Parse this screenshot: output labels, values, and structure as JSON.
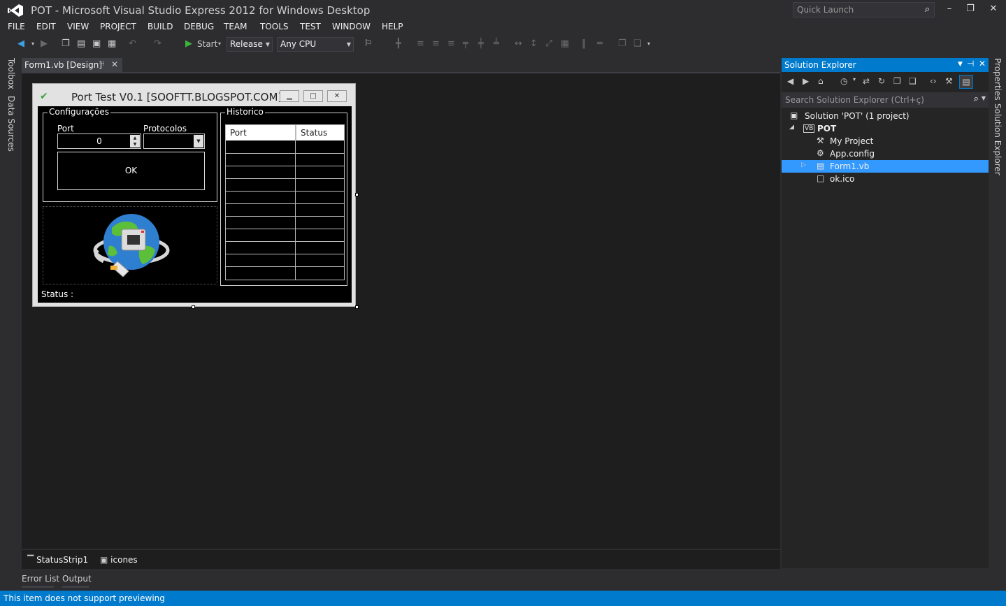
{
  "window": {
    "title": "POT - Microsoft Visual Studio Express 2012 for Windows Desktop",
    "quick_launch_placeholder": "Quick Launch",
    "minimize_glyph": "–",
    "restore_glyph": "❐",
    "close_glyph": "✕"
  },
  "menu": [
    "FILE",
    "EDIT",
    "VIEW",
    "PROJECT",
    "BUILD",
    "DEBUG",
    "TEAM",
    "TOOLS",
    "TEST",
    "WINDOW",
    "HELP"
  ],
  "toolbar": {
    "start_label": "Start",
    "configuration": "Release",
    "platform": "Any CPU"
  },
  "left_rail": {
    "toolbox": "Toolbox",
    "data_sources": "Data Sources"
  },
  "document_tab": {
    "label": "Form1.vb [Design]"
  },
  "form": {
    "title": "Port Test V0.1 [SOOFTT.BLOGSPOT.COM]",
    "config_group": "Configurações",
    "port_label": "Port",
    "port_value": "0",
    "protocol_label": "Protocolos",
    "protocol_value": "",
    "ok_label": "OK",
    "status_label": "Status :",
    "history_group": "Historico",
    "history_columns": [
      "Port",
      "Status"
    ]
  },
  "tray": {
    "item1": "StatusStrip1",
    "item2": "icones"
  },
  "bottom_tabs": {
    "error_list": "Error List",
    "output": "Output"
  },
  "solution_explorer": {
    "title": "Solution Explorer",
    "search_placeholder": "Search Solution Explorer (Ctrl+ç)",
    "tree": [
      {
        "label": "Solution 'POT' (1 project)"
      },
      {
        "label": "POT"
      },
      {
        "label": "My Project"
      },
      {
        "label": "App.config"
      },
      {
        "label": "Form1.vb"
      },
      {
        "label": "ok.ico"
      }
    ]
  },
  "right_rail": {
    "properties": "Properties",
    "solution_explorer": "Solution Explorer"
  },
  "status_bar": {
    "text": "This item does not support previewing"
  },
  "colors": {
    "accent": "#007acc",
    "selection": "#3399ff",
    "background": "#2d2d30",
    "design_surface": "#1e1e1e"
  }
}
